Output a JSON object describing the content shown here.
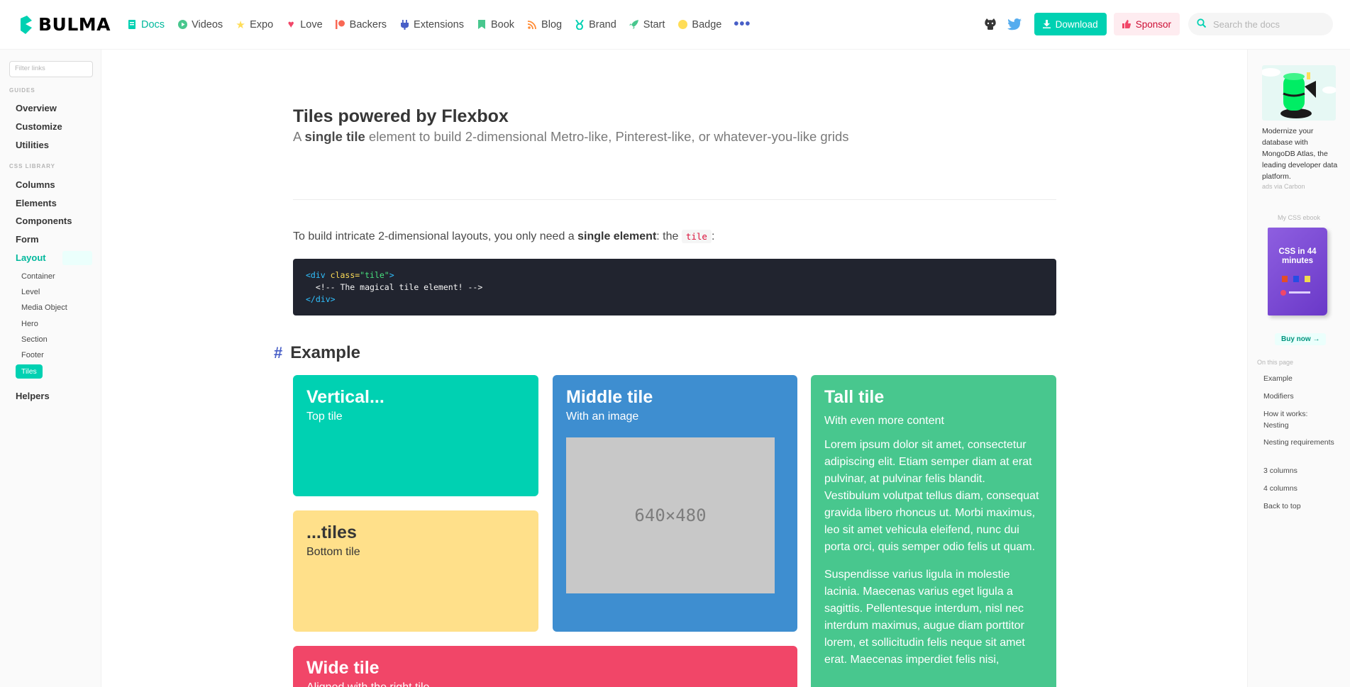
{
  "nav": {
    "brand": "BULMA",
    "items": [
      {
        "label": "Docs",
        "icon": "docs-icon",
        "color": "#00d1b2"
      },
      {
        "label": "Videos",
        "icon": "play-icon",
        "color": "#48c78e"
      },
      {
        "label": "Expo",
        "icon": "star-icon",
        "color": "#ffdd57"
      },
      {
        "label": "Love",
        "icon": "heart-icon",
        "color": "#f14668"
      },
      {
        "label": "Backers",
        "icon": "patreon-icon",
        "color": "#f96854"
      },
      {
        "label": "Extensions",
        "icon": "plug-icon",
        "color": "#485fc7"
      },
      {
        "label": "Book",
        "icon": "bookmark-icon",
        "color": "#48c78e"
      },
      {
        "label": "Blog",
        "icon": "rss-icon",
        "color": "#ff8c36"
      },
      {
        "label": "Brand",
        "icon": "medal-icon",
        "color": "#00d1b2"
      },
      {
        "label": "Start",
        "icon": "rocket-icon",
        "color": "#48c78e"
      },
      {
        "label": "Badge",
        "icon": "circle-icon",
        "color": "#ffdd57"
      }
    ],
    "download": "Download",
    "sponsor": "Sponsor",
    "search_placeholder": "Search the docs"
  },
  "sidebar": {
    "filter_placeholder": "Filter links",
    "guides_label": "GUIDES",
    "guides": [
      "Overview",
      "Customize",
      "Utilities"
    ],
    "library_label": "CSS LIBRARY",
    "library": [
      "Columns",
      "Elements",
      "Components",
      "Form",
      "Layout"
    ],
    "layout_sub": [
      "Container",
      "Level",
      "Media Object",
      "Hero",
      "Section",
      "Footer",
      "Tiles"
    ],
    "helpers": "Helpers"
  },
  "main": {
    "title": "Tiles powered by Flexbox",
    "subtitle_pre": "A ",
    "subtitle_bold": "single tile",
    "subtitle_post": " element to build 2-dimensional Metro-like, Pinterest-like, or whatever-you-like grids",
    "intro_pre": "To build intricate 2-dimensional layouts, you only need a ",
    "intro_bold": "single element",
    "intro_mid": ": the ",
    "intro_code": "tile",
    "intro_post": ":",
    "code": {
      "open_tag": "<div ",
      "attr": "class=",
      "attr_val": "\"tile\"",
      "open_end": ">",
      "comment": "  <!-- The magical tile element! -->",
      "close_tag": "</div>"
    },
    "section_hash": "#",
    "section": "Example",
    "tiles": {
      "vertical": {
        "title": "Vertical...",
        "sub": "Top tile"
      },
      "tiles": {
        "title": "...tiles",
        "sub": "Bottom tile"
      },
      "middle": {
        "title": "Middle tile",
        "sub": "With an image",
        "image": "640×480"
      },
      "tall": {
        "title": "Tall tile",
        "sub": "With even more content",
        "p1": "Lorem ipsum dolor sit amet, consectetur adipiscing elit. Etiam semper diam at erat pulvinar, at pulvinar felis blandit. Vestibulum volutpat tellus diam, consequat gravida libero rhoncus ut. Morbi maximus, leo sit amet vehicula eleifend, nunc dui porta orci, quis semper odio felis ut quam.",
        "p2": "Suspendisse varius ligula in molestie lacinia. Maecenas varius eget ligula a sagittis. Pellentesque interdum, nisl nec interdum maximus, augue diam porttitor lorem, et sollicitudin felis neque sit amet erat. Maecenas imperdiet felis nisi,"
      },
      "wide": {
        "title": "Wide tile",
        "sub": "Aligned with the right tile"
      }
    }
  },
  "right": {
    "ad_text": "Modernize your database with MongoDB Atlas, the leading developer data platform.",
    "ad_via": "ads via Carbon",
    "ebook_label": "My CSS ebook",
    "ebook_title": "CSS in 44 minutes",
    "buy": "Buy now →",
    "on_this_page": "On this page",
    "toc": [
      "Example",
      "Modifiers",
      "How it works: Nesting",
      "Nesting requirements",
      "3 columns",
      "4 columns",
      "Back to top"
    ]
  }
}
